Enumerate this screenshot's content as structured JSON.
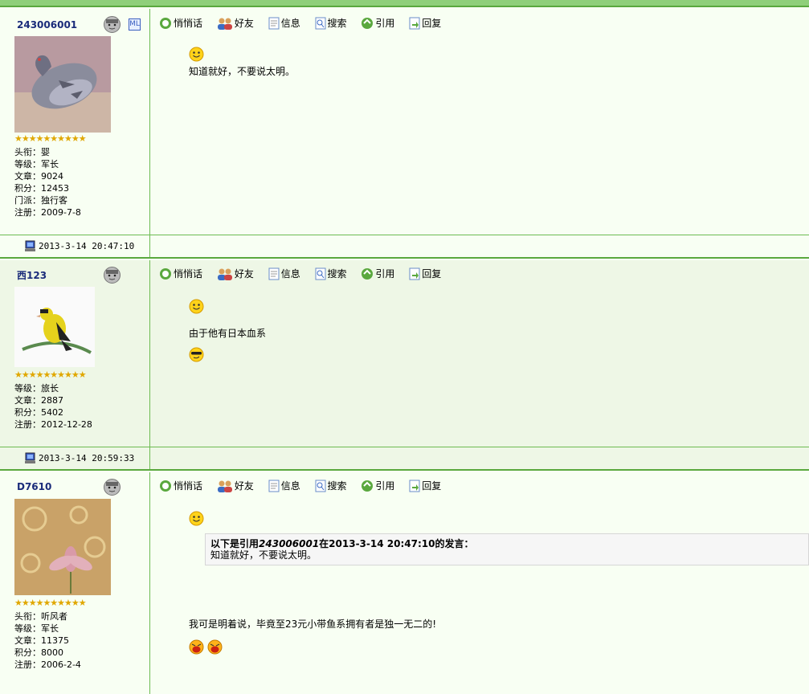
{
  "toolbar": {
    "whisper": "悄悄话",
    "friend": "好友",
    "info": "信息",
    "search": "搜索",
    "quote": "引用",
    "reply": "回复"
  },
  "posts": [
    {
      "username": "243006001",
      "stars": "★★★★★★★★★★",
      "meta": [
        "头衔：婴",
        "等级：军长",
        "文章：9024",
        "积分：12453",
        "门派：独行客",
        "注册：2009-7-8"
      ],
      "message": "知道就好，不要说太明。",
      "time": "2013-3-14 20:47:10",
      "sign_icon": "ML"
    },
    {
      "username": "西123",
      "stars": "★★★★★★★★★★",
      "meta": [
        "等级：旅长",
        "文章：2887",
        "积分：5402",
        "注册：2012-12-28"
      ],
      "message": "由于他有日本血系",
      "time": "2013-3-14 20:59:33"
    },
    {
      "username": "D7610",
      "stars": "★★★★★★★★★★",
      "meta": [
        "头衔：听风者",
        "等级：军长",
        "文章：11375",
        "积分：8000",
        "注册：2006-2-4"
      ],
      "quote_prefix": "以下是引用",
      "quote_user": "243006001",
      "quote_mid": "在2013-3-14 20:47:10的发言：",
      "quote_text": "知道就好，不要说太明。",
      "message": "我可是明着说，毕竟至23元小带鱼系拥有者是独一无二的!"
    }
  ],
  "colors": {
    "border": "#6dbb52",
    "alt_bg": "#eef7e6",
    "bg": "#f8fff3"
  }
}
